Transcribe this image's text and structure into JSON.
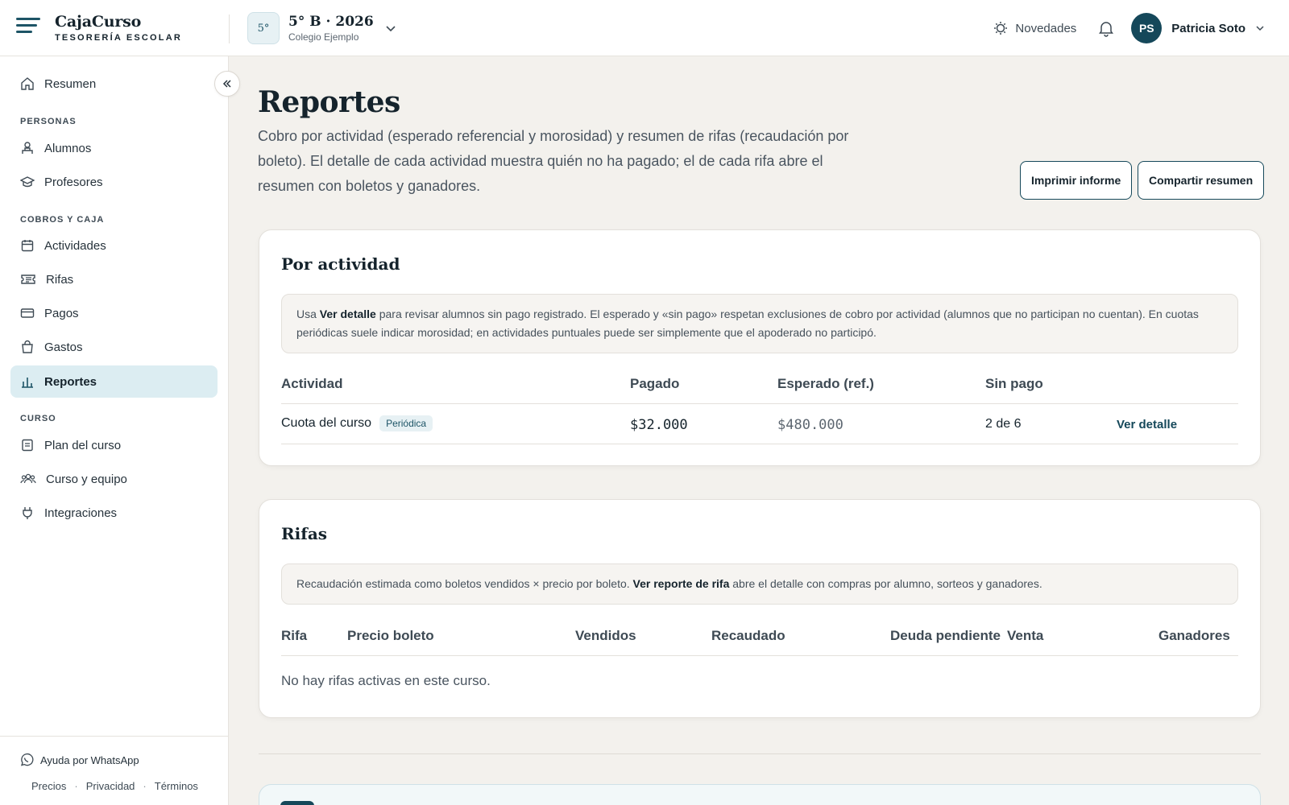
{
  "header": {
    "brand_name": "CajaCurso",
    "brand_sub": "TESORERÍA ESCOLAR",
    "course_badge": "5°",
    "course_title": "5° B · 2026",
    "course_school": "Colegio Ejemplo",
    "news_label": "Novedades",
    "user_initials": "PS",
    "user_name": "Patricia Soto"
  },
  "sidebar": {
    "resumen": "Resumen",
    "section_personas": "PERSONAS",
    "alumnos": "Alumnos",
    "profesores": "Profesores",
    "section_cobros": "COBROS Y CAJA",
    "actividades": "Actividades",
    "rifas": "Rifas",
    "pagos": "Pagos",
    "gastos": "Gastos",
    "reportes": "Reportes",
    "section_curso": "CURSO",
    "plan": "Plan del curso",
    "equipo": "Curso y equipo",
    "integraciones": "Integraciones",
    "whatsapp": "Ayuda por WhatsApp",
    "precios": "Precios",
    "privacidad": "Privacidad",
    "terminos": "Términos",
    "dot": "·"
  },
  "page": {
    "title": "Reportes",
    "description": "Cobro por actividad (esperado referencial y morosidad) y resumen de rifas (recaudación por boleto). El detalle de cada actividad muestra quién no ha pagado; el de cada rifa abre el resumen con boletos y ganadores.",
    "print_button": "Imprimir informe",
    "share_button": "Compartir resumen"
  },
  "activity": {
    "title": "Por actividad",
    "note_pre": "Usa ",
    "note_bold": "Ver detalle",
    "note_post": " para revisar alumnos sin pago registrado. El esperado y «sin pago» respetan exclusiones de cobro por actividad (alumnos que no participan no cuentan). En cuotas periódicas suele indicar morosidad; en actividades puntuales puede ser simplemente que el apoderado no participó.",
    "columns": {
      "actividad": "Actividad",
      "pagado": "Pagado",
      "esperado": "Esperado (ref.)",
      "sin_pago": "Sin pago"
    },
    "rows": [
      {
        "name": "Cuota del curso",
        "tag": "Periódica",
        "pagado": "$32.000",
        "esperado": "$480.000",
        "sin_pago": "2 de 6",
        "action": "Ver detalle"
      }
    ]
  },
  "raffles": {
    "title": "Rifas",
    "note_pre": "Recaudación estimada como boletos vendidos × precio por boleto. ",
    "note_bold": "Ver reporte de rifa",
    "note_post": " abre el detalle con compras por alumno, sorteos y ganadores.",
    "columns": {
      "rifa": "Rifa",
      "precio": "Precio boleto",
      "vendidos": "Vendidos",
      "recaudado": "Recaudado",
      "deuda": "Deuda pendiente",
      "venta": "Venta",
      "ganadores": "Ganadores"
    },
    "empty": "No hay rifas activas en este curso."
  }
}
